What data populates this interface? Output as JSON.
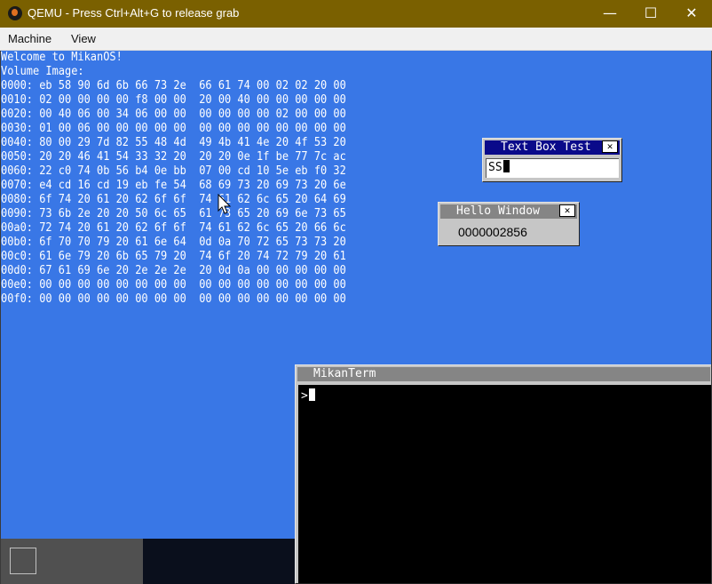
{
  "window": {
    "title": "QEMU - Press Ctrl+Alt+G to release grab",
    "app_icon": "qemu-logo-icon",
    "controls": {
      "minimize": "—",
      "maximize": "☐",
      "close": "✕"
    }
  },
  "menu": [
    "Machine",
    "View"
  ],
  "console": {
    "lines": [
      "Welcome to MikanOS!",
      "Volume Image:",
      "0000: eb 58 90 6d 6b 66 73 2e  66 61 74 00 02 02 20 00",
      "0010: 02 00 00 00 00 f8 00 00  20 00 40 00 00 00 00 00",
      "0020: 00 40 06 00 34 06 00 00  00 00 00 00 02 00 00 00",
      "0030: 01 00 06 00 00 00 00 00  00 00 00 00 00 00 00 00",
      "0040: 80 00 29 7d 82 55 48 4d  49 4b 41 4e 20 4f 53 20",
      "0050: 20 20 46 41 54 33 32 20  20 20 0e 1f be 77 7c ac",
      "0060: 22 c0 74 0b 56 b4 0e bb  07 00 cd 10 5e eb f0 32",
      "0070: e4 cd 16 cd 19 eb fe 54  68 69 73 20 69 73 20 6e",
      "0080: 6f 74 20 61 20 62 6f 6f  74 61 62 6c 65 20 64 69",
      "0090: 73 6b 2e 20 20 50 6c 65  61 73 65 20 69 6e 73 65",
      "00a0: 72 74 20 61 20 62 6f 6f  74 61 62 6c 65 20 66 6c",
      "00b0: 6f 70 70 79 20 61 6e 64  0d 0a 70 72 65 73 73 20",
      "00c0: 61 6e 79 20 6b 65 79 20  74 6f 20 74 72 79 20 61",
      "00d0: 67 61 69 6e 20 2e 2e 2e  20 0d 0a 00 00 00 00 00",
      "00e0: 00 00 00 00 00 00 00 00  00 00 00 00 00 00 00 00",
      "00f0: 00 00 00 00 00 00 00 00  00 00 00 00 00 00 00 00"
    ]
  },
  "textbox_window": {
    "title": "Text Box Test",
    "value": "SS"
  },
  "hello_window": {
    "title": "Hello Window",
    "counter": "0000002856"
  },
  "terminal_window": {
    "title": "MikanTerm",
    "prompt": ">"
  },
  "colors": {
    "desktop": "#3977e6",
    "titlebar": "#7a6000",
    "active_window_title": "#0a0a8a",
    "inactive_window_title": "#858585",
    "window_body": "#c6c6c6"
  }
}
